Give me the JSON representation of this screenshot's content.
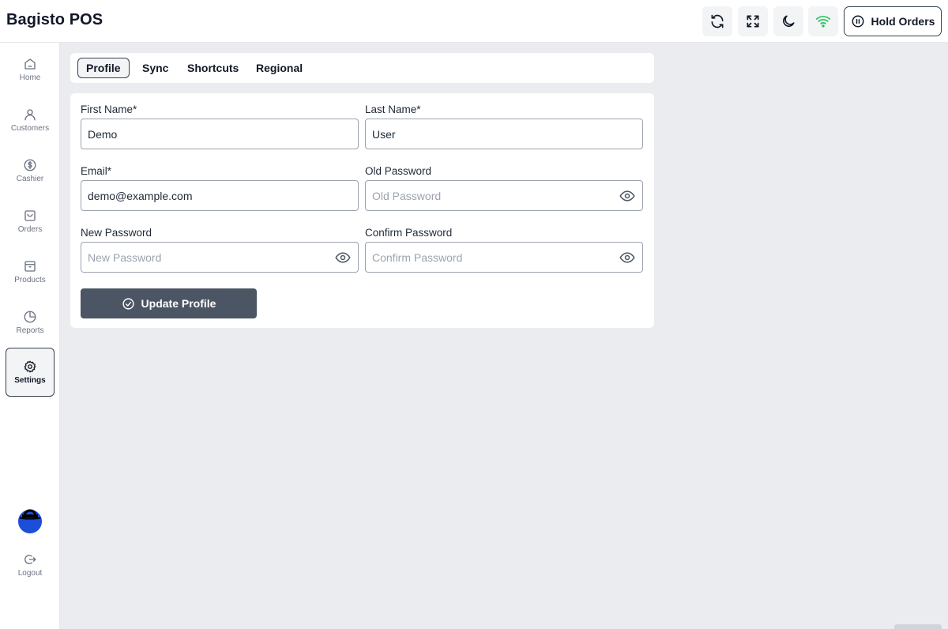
{
  "app": {
    "title": "Bagisto POS"
  },
  "header": {
    "buttons": [
      {
        "icon": "sync-icon"
      },
      {
        "icon": "fullscreen-icon"
      },
      {
        "icon": "moon-icon"
      },
      {
        "icon": "wifi-icon",
        "color": "#22c55e"
      }
    ],
    "hold_orders_label": "Hold Orders"
  },
  "sidebar": {
    "items": [
      {
        "label": "Home",
        "icon": "home-icon"
      },
      {
        "label": "Customers",
        "icon": "user-icon"
      },
      {
        "label": "Cashier",
        "icon": "dollar-icon"
      },
      {
        "label": "Orders",
        "icon": "bag-icon"
      },
      {
        "label": "Products",
        "icon": "archive-icon"
      },
      {
        "label": "Reports",
        "icon": "pie-chart-icon"
      },
      {
        "label": "Settings",
        "icon": "gear-icon",
        "active": true
      }
    ],
    "logout_label": "Logout"
  },
  "tabs": [
    {
      "label": "Profile",
      "active": true
    },
    {
      "label": "Sync"
    },
    {
      "label": "Shortcuts"
    },
    {
      "label": "Regional"
    }
  ],
  "profile_form": {
    "first_name": {
      "label": "First Name*",
      "value": "Demo"
    },
    "last_name": {
      "label": "Last Name*",
      "value": "User"
    },
    "email": {
      "label": "Email*",
      "value": "demo@example.com"
    },
    "old_password": {
      "label": "Old Password",
      "placeholder": "Old Password"
    },
    "new_password": {
      "label": "New Password",
      "placeholder": "New Password"
    },
    "confirm_password": {
      "label": "Confirm Password",
      "placeholder": "Confirm Password"
    },
    "submit_label": "Update Profile"
  },
  "colors": {
    "accent": "#4b5563",
    "active_border": "#374151",
    "page_bg": "#ebecf0",
    "wifi": "#22c55e",
    "avatar": "#1d4ed8"
  }
}
